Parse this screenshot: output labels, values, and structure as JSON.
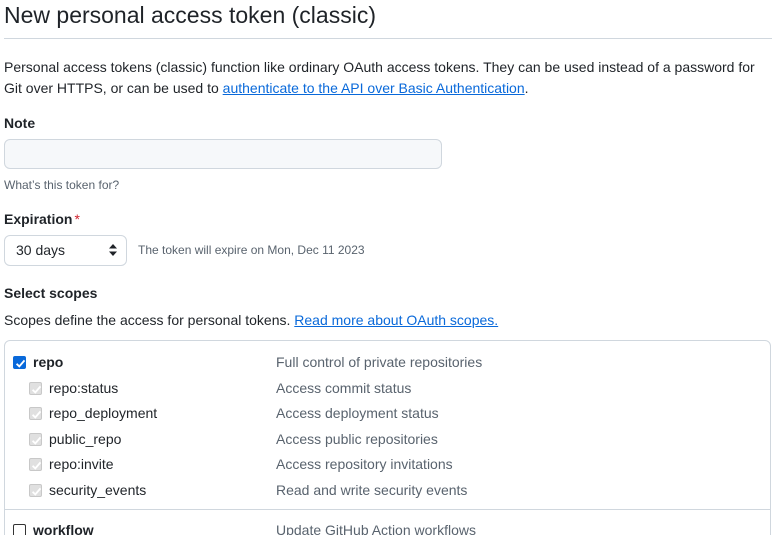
{
  "page": {
    "title": "New personal access token (classic)",
    "intro_text": "Personal access tokens (classic) function like ordinary OAuth access tokens. They can be used instead of a password for Git over HTTPS, or can be used to ",
    "intro_link": "authenticate to the API over Basic Authentication",
    "intro_end": "."
  },
  "note": {
    "label": "Note",
    "value": "",
    "placeholder": "",
    "hint": "What’s this token for?"
  },
  "expiration": {
    "label": "Expiration",
    "required_mark": "*",
    "selected": "30 days",
    "note": "The token will expire on Mon, Dec 11 2023"
  },
  "scopes": {
    "label": "Select scopes",
    "description": "Scopes define the access for personal tokens. ",
    "link": "Read more about OAuth scopes.",
    "groups": [
      {
        "name": "repo",
        "desc": "Full control of private repositories",
        "checked": true,
        "children": [
          {
            "name": "repo:status",
            "desc": "Access commit status",
            "checked": true
          },
          {
            "name": "repo_deployment",
            "desc": "Access deployment status",
            "checked": true
          },
          {
            "name": "public_repo",
            "desc": "Access public repositories",
            "checked": true
          },
          {
            "name": "repo:invite",
            "desc": "Access repository invitations",
            "checked": true
          },
          {
            "name": "security_events",
            "desc": "Read and write security events",
            "checked": true
          }
        ]
      },
      {
        "name": "workflow",
        "desc": "Update GitHub Action workflows",
        "checked": false,
        "children": []
      }
    ]
  },
  "colors": {
    "accent": "#0969da",
    "required": "#cf222e",
    "muted_text": "#59636e",
    "border": "#d0d7de",
    "input_bg": "#f6f8fa"
  }
}
